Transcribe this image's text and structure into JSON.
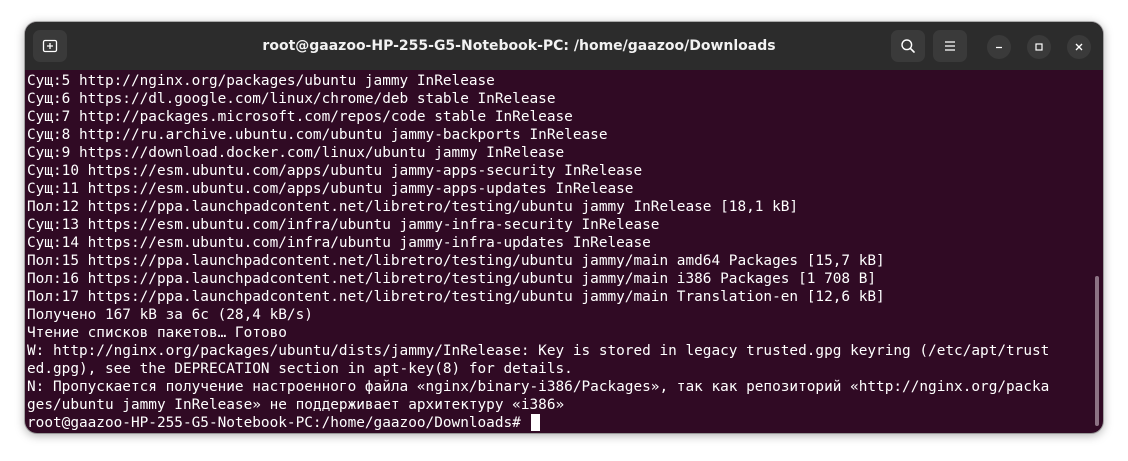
{
  "window": {
    "title": "root@gaazoo-HP-255-G5-Notebook-PC: /home/gaazoo/Downloads"
  },
  "icons": {
    "new_tab": "new-tab-icon",
    "search": "search-icon",
    "menu": "hamburger-menu-icon",
    "minimize": "minimize-icon",
    "maximize": "maximize-icon",
    "close": "close-icon"
  },
  "colors": {
    "terminal_bg": "#300a24",
    "titlebar_bg": "#2c2c2c",
    "text": "#ffffff"
  },
  "terminal": {
    "lines": [
      "Сущ:5 http://nginx.org/packages/ubuntu jammy InRelease",
      "Сущ:6 https://dl.google.com/linux/chrome/deb stable InRelease",
      "Сущ:7 http://packages.microsoft.com/repos/code stable InRelease",
      "Сущ:8 http://ru.archive.ubuntu.com/ubuntu jammy-backports InRelease",
      "Сущ:9 https://download.docker.com/linux/ubuntu jammy InRelease",
      "Сущ:10 https://esm.ubuntu.com/apps/ubuntu jammy-apps-security InRelease",
      "Сущ:11 https://esm.ubuntu.com/apps/ubuntu jammy-apps-updates InRelease",
      "Пол:12 https://ppa.launchpadcontent.net/libretro/testing/ubuntu jammy InRelease [18,1 kB]",
      "Сущ:13 https://esm.ubuntu.com/infra/ubuntu jammy-infra-security InRelease",
      "Сущ:14 https://esm.ubuntu.com/infra/ubuntu jammy-infra-updates InRelease",
      "Пол:15 https://ppa.launchpadcontent.net/libretro/testing/ubuntu jammy/main amd64 Packages [15,7 kB]",
      "Пол:16 https://ppa.launchpadcontent.net/libretro/testing/ubuntu jammy/main i386 Packages [1 708 B]",
      "Пол:17 https://ppa.launchpadcontent.net/libretro/testing/ubuntu jammy/main Translation-en [12,6 kB]",
      "Получено 167 kB за 6с (28,4 kB/s)",
      "Чтение списков пакетов… Готово",
      "W: http://nginx.org/packages/ubuntu/dists/jammy/InRelease: Key is stored in legacy trusted.gpg keyring (/etc/apt/trust",
      "ed.gpg), see the DEPRECATION section in apt-key(8) for details.",
      "N: Пропускается получение настроенного файла «nginx/binary-i386/Packages», так как репозиторий «http://nginx.org/packa",
      "ges/ubuntu jammy InRelease» не поддерживает архитектуру «i386»"
    ],
    "prompt": "root@gaazoo-HP-255-G5-Notebook-PC:/home/gaazoo/Downloads# "
  }
}
